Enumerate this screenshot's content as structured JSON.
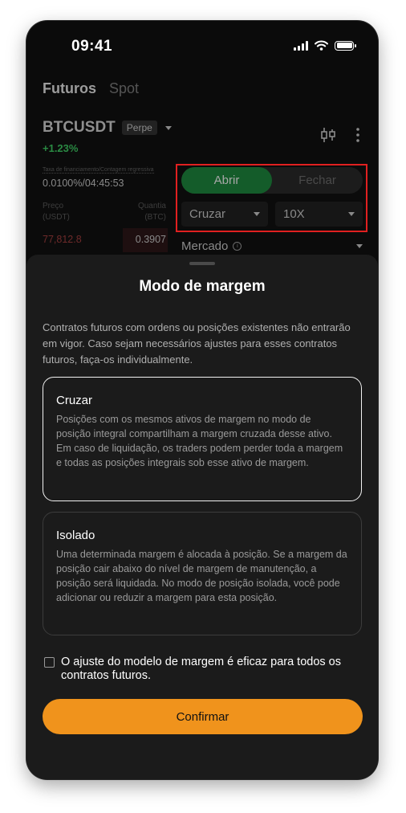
{
  "status_bar": {
    "time": "09:41"
  },
  "tabs": [
    {
      "label": "Futuros"
    },
    {
      "label": "Spot"
    }
  ],
  "pair": {
    "name": "BTCUSDT",
    "badge": "Perpe",
    "change": "+1.23%"
  },
  "funding": {
    "label": "Taxa de financiamento/Contagem regressiva",
    "value": "0.0100%/04:45:53"
  },
  "order_book": {
    "price_header": [
      "Preço",
      "(USDT)"
    ],
    "qty_header": [
      "Quantia",
      "(BTC)"
    ],
    "rows": [
      {
        "price": "77,812.8",
        "qty": "0.3907"
      }
    ]
  },
  "order_form": {
    "open_label": "Abrir",
    "close_label": "Fechar",
    "margin_mode": "Cruzar",
    "leverage": "10X",
    "order_type": "Mercado"
  },
  "sheet": {
    "title": "Modo de margem",
    "description": "Contratos futuros com ordens ou posições existentes não entrarão em vigor. Caso sejam necessários ajustes para esses contratos futuros, faça-os individualmente.",
    "options": [
      {
        "title": "Cruzar",
        "text": "Posições com os mesmos ativos de margem no modo de posição integral compartilham a margem cruzada desse ativo. Em caso de liquidação, os traders podem perder toda a margem e todas as posições integrais sob esse ativo de margem.",
        "selected": true
      },
      {
        "title": "Isolado",
        "text": "Uma determinada margem é alocada à posição. Se a margem da posição cair abaixo do nível de margem de manutenção, a posição será liquidada. No modo de posição isolada, você pode adicionar ou reduzir a margem para esta posição.",
        "selected": false
      }
    ],
    "checkbox_label": "O ajuste do modelo de margem é eficaz para todos os contratos futuros.",
    "checkbox_checked": false,
    "confirm_label": "Confirmar"
  },
  "colors": {
    "accent": "#f0931c",
    "buy_green": "#145c2a",
    "positive_text": "#2a8a43",
    "sell_red": "#6e2a2a",
    "highlight_outline": "#e02020"
  },
  "icons": [
    "signal-icon",
    "wifi-icon",
    "battery-icon",
    "caret-down-icon",
    "candlestick-chart-icon",
    "more-vertical-icon",
    "info-icon",
    "checkbox-icon"
  ]
}
